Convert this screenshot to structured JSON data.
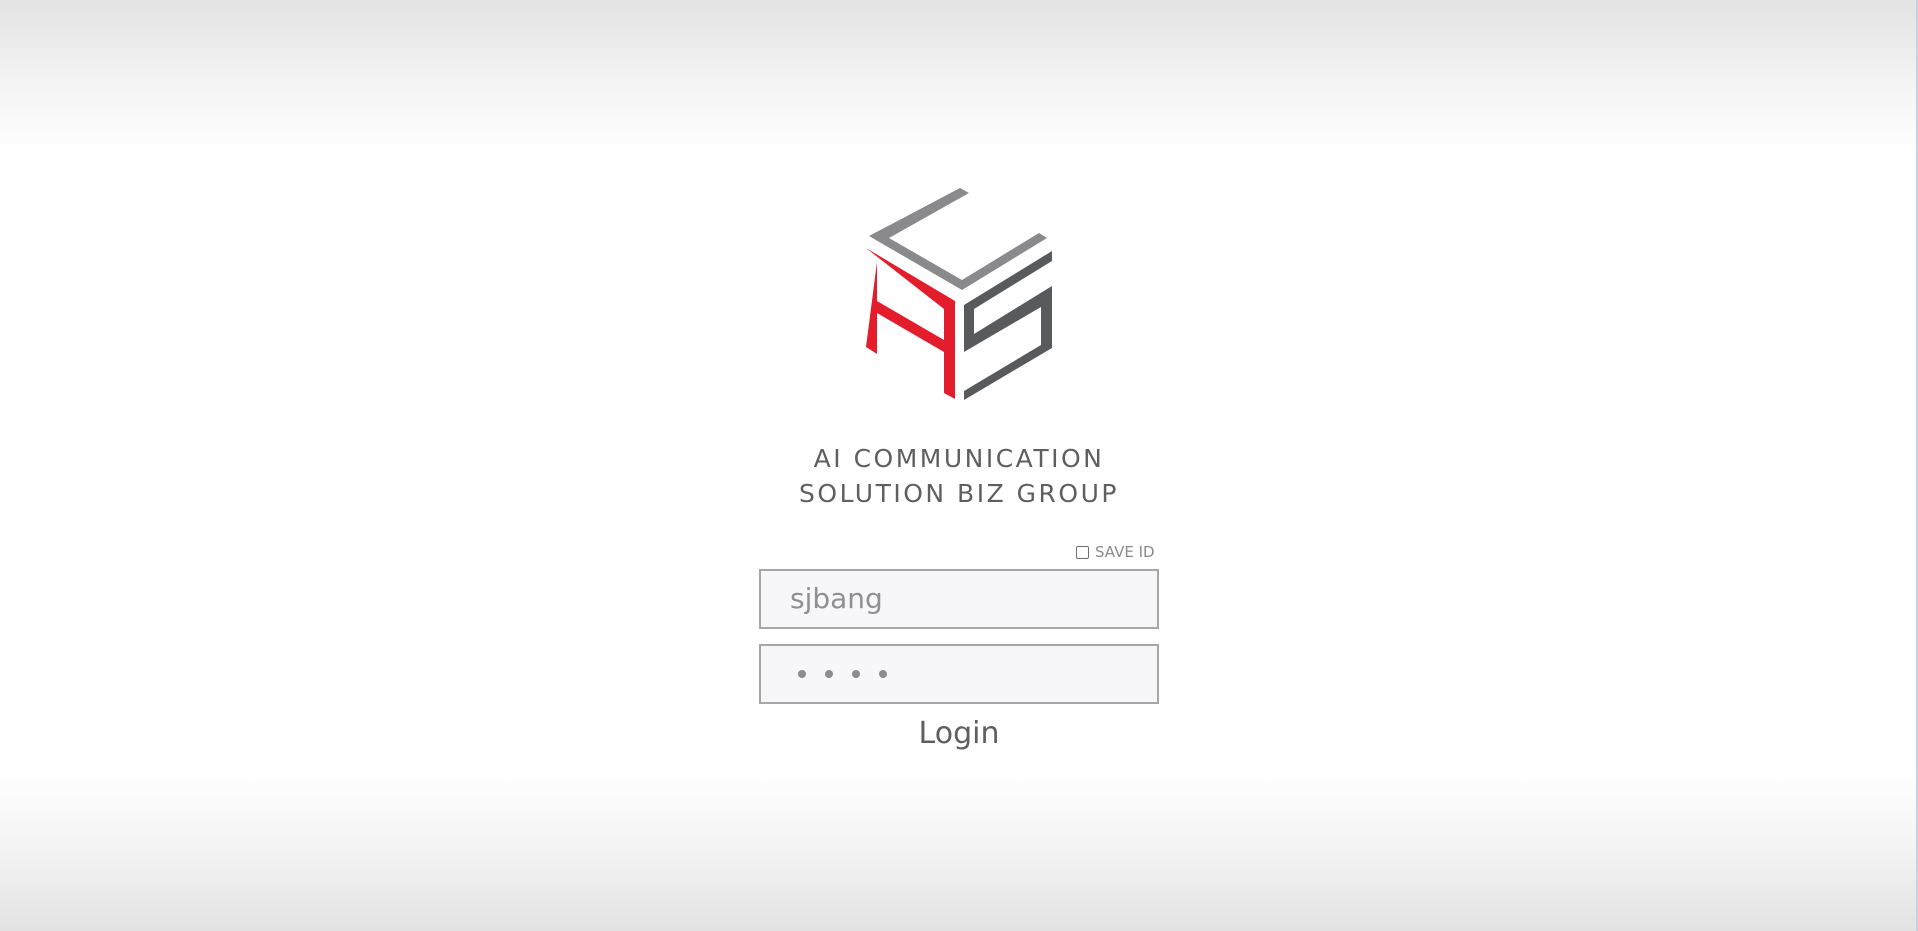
{
  "logo": {
    "name": "aics-cube-logo",
    "colors": {
      "red": "#e31d2b",
      "light_gray": "#8a8a8c",
      "dark_gray": "#595a5c"
    }
  },
  "tagline": {
    "line1": "AI COMMUNICATION",
    "line2": "SOLUTION BIZ GROUP"
  },
  "save_id": {
    "label": "SAVE ID",
    "checked": false
  },
  "form": {
    "id_value": "sjbang",
    "password_masked": "••••",
    "login_label": "Login"
  }
}
